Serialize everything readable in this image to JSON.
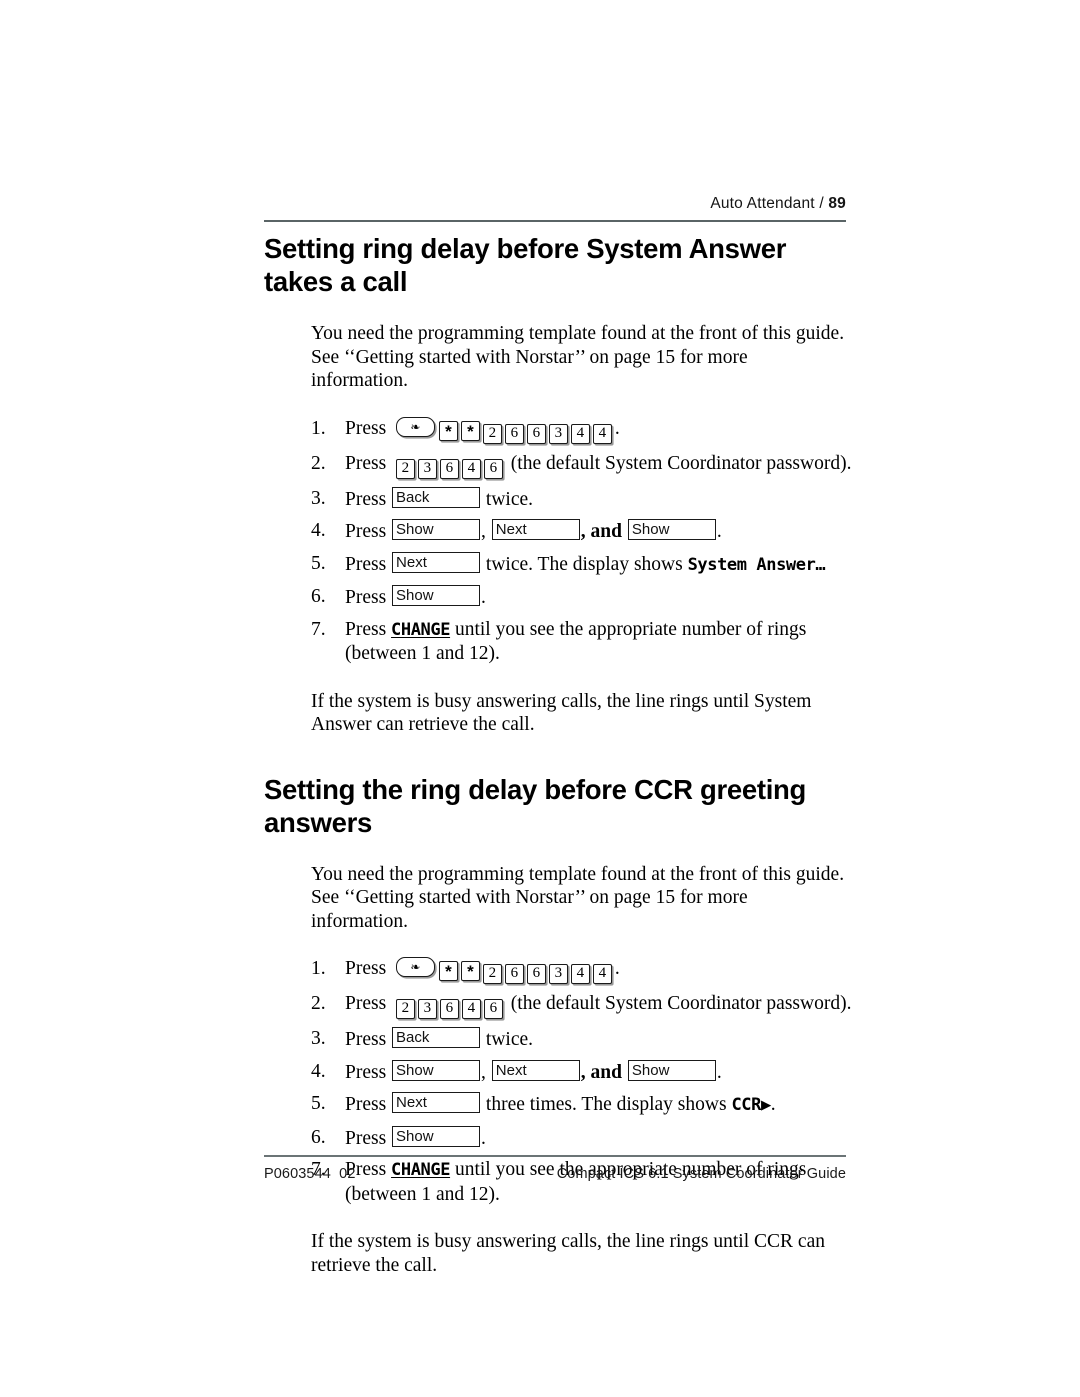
{
  "header": {
    "chapter": "Auto Attendant",
    "separator": " / ",
    "page_number": "89"
  },
  "footer": {
    "doc_code": "P0603544  02",
    "guide_title": "Compact ICS 6.1 System Coordinator Guide"
  },
  "keys": {
    "feature": "Feature",
    "feature_glyph": "❧",
    "star": "*",
    "d2": "2",
    "d3": "3",
    "d4": "4",
    "d6": "6",
    "back": "Back",
    "show": "Show",
    "next": "Next"
  },
  "sections": [
    {
      "id": "system-answer",
      "heading": "Setting ring delay before System Answer takes a call",
      "intro": "You need the programming template found at the front of this guide. See ‘‘Getting started with Norstar’’ on page 15 for more information.",
      "steps": [
        {
          "num": "1.",
          "verb": "Press",
          "keypad": [
            "FEATURE",
            "*",
            "*",
            "2",
            "6",
            "6",
            "3",
            "4",
            "4"
          ],
          "tail": "."
        },
        {
          "num": "2.",
          "verb": "Press",
          "keypad": [
            "2",
            "3",
            "6",
            "4",
            "6"
          ],
          "tail": "(the default System Coordinator password)."
        },
        {
          "num": "3.",
          "verb": "Press",
          "softkeys": [
            "Back"
          ],
          "tail": "twice."
        },
        {
          "num": "4.",
          "verb": "Press",
          "softkeys": [
            "Show",
            "Next",
            "Show"
          ],
          "sep1": ",",
          "sep2": ", and",
          "tail": "."
        },
        {
          "num": "5.",
          "verb": "Press",
          "softkeys": [
            "Next"
          ],
          "tail": "twice. The display shows",
          "display": "System Answer…"
        },
        {
          "num": "6.",
          "verb": "Press",
          "softkeys": [
            "Show"
          ],
          "tail": "."
        },
        {
          "num": "7.",
          "verb": "Press",
          "display_softkey": "CHANGE",
          "tail": "until you see the appropriate number of rings (between 1 and 12)."
        }
      ],
      "outro": "If the system is busy answering calls, the line rings until System Answer can retrieve the call."
    },
    {
      "id": "ccr-greeting",
      "heading": "Setting the ring delay before CCR greeting answers",
      "intro": "You need the programming template found at the front of this guide. See ‘‘Getting started with Norstar’’ on page 15 for more information.",
      "steps": [
        {
          "num": "1.",
          "verb": "Press",
          "keypad": [
            "FEATURE",
            "*",
            "*",
            "2",
            "6",
            "6",
            "3",
            "4",
            "4"
          ],
          "tail": "."
        },
        {
          "num": "2.",
          "verb": "Press",
          "keypad": [
            "2",
            "3",
            "6",
            "4",
            "6"
          ],
          "tail": "(the default System Coordinator password)."
        },
        {
          "num": "3.",
          "verb": "Press",
          "softkeys": [
            "Back"
          ],
          "tail": "twice."
        },
        {
          "num": "4.",
          "verb": "Press",
          "softkeys": [
            "Show",
            "Next",
            "Show"
          ],
          "sep1": ",",
          "sep2": ", and",
          "tail": "."
        },
        {
          "num": "5.",
          "verb": "Press",
          "softkeys": [
            "Next"
          ],
          "tail": "three times. The display shows",
          "display": "CCR▶",
          "display_tail": "."
        },
        {
          "num": "6.",
          "verb": "Press",
          "softkeys": [
            "Show"
          ],
          "tail": "."
        },
        {
          "num": "7.",
          "verb": "Press",
          "display_softkey": "CHANGE",
          "tail": "until you see the appropriate number of rings (between 1 and 12)."
        }
      ],
      "outro": "If the system is busy answering calls, the line rings until CCR can retrieve the call."
    }
  ]
}
